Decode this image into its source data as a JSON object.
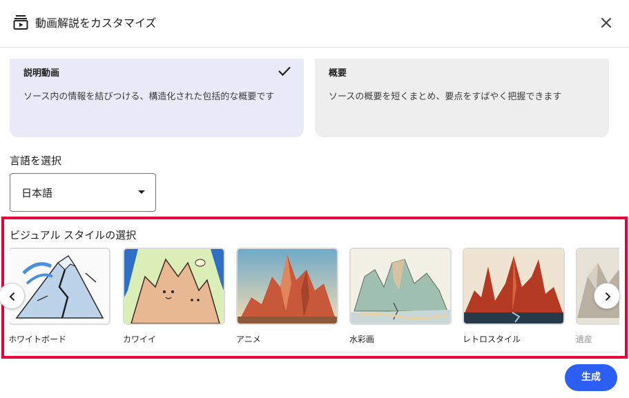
{
  "header": {
    "title": "動画解説をカスタマイズ",
    "icon": "video-overview-icon",
    "close_icon": "close-icon"
  },
  "format_cards": [
    {
      "title": "説明動画",
      "description": "ソース内の情報を結びつける、構造化された包括的な概要です",
      "selected": true,
      "check_icon": "check-icon"
    },
    {
      "title": "概要",
      "description": "ソースの概要を短くまとめ、要点をすばやく把握できます",
      "selected": false
    }
  ],
  "language": {
    "label": "言語を選択",
    "selected": "日本語"
  },
  "visual_style": {
    "label": "ビジュアル スタイルの選択",
    "prev_icon": "chevron-left-icon",
    "next_icon": "chevron-right-icon",
    "items": [
      {
        "label": "ホワイトボード"
      },
      {
        "label": "カワイイ"
      },
      {
        "label": "アニメ"
      },
      {
        "label": "水彩画"
      },
      {
        "label": "レトロスタイル"
      },
      {
        "label": "遺産"
      }
    ]
  },
  "actions": {
    "generate_label": "生成"
  },
  "colors": {
    "accent": "#2d5ff5",
    "highlight": "#e8003a",
    "selected_card": "#e8eaf7",
    "unselected_card": "#eeeeee"
  }
}
